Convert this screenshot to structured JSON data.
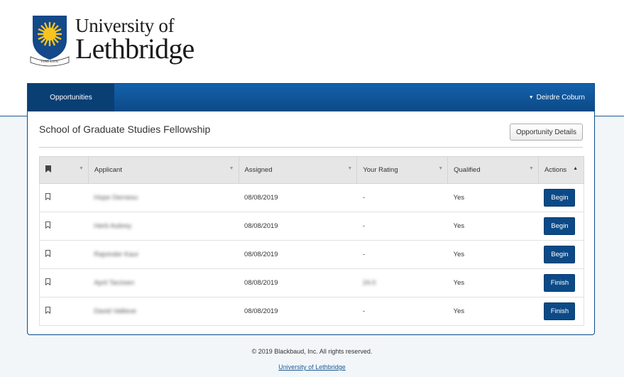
{
  "logo": {
    "line1": "University of",
    "line2": "Lethbridge",
    "motto": "FIAT LUX"
  },
  "nav": {
    "tab": "Opportunities",
    "user": "Deirdre Coburn"
  },
  "page": {
    "title": "School of Graduate Studies Fellowship",
    "details_button": "Opportunity Details"
  },
  "table": {
    "headers": [
      "Applicant",
      "Assigned",
      "Your Rating",
      "Qualified",
      "Actions"
    ],
    "rows": [
      {
        "applicant": "Hope Oernesu",
        "assigned": "08/08/2019",
        "rating": "-",
        "qualified": "Yes",
        "action": "Begin"
      },
      {
        "applicant": "Herb Aubrey",
        "assigned": "08/08/2019",
        "rating": "-",
        "qualified": "Yes",
        "action": "Begin"
      },
      {
        "applicant": "Rajvinder Kaur",
        "assigned": "08/08/2019",
        "rating": "-",
        "qualified": "Yes",
        "action": "Begin"
      },
      {
        "applicant": "April Tarzisen",
        "assigned": "08/08/2019",
        "rating": "24.0",
        "qualified": "Yes",
        "action": "Finish"
      },
      {
        "applicant": "David Vallieve",
        "assigned": "08/08/2019",
        "rating": "-",
        "qualified": "Yes",
        "action": "Finish"
      }
    ]
  },
  "footer": {
    "copyright": "© 2019 Blackbaud, Inc. All rights reserved.",
    "link": "University of Lethbridge"
  }
}
